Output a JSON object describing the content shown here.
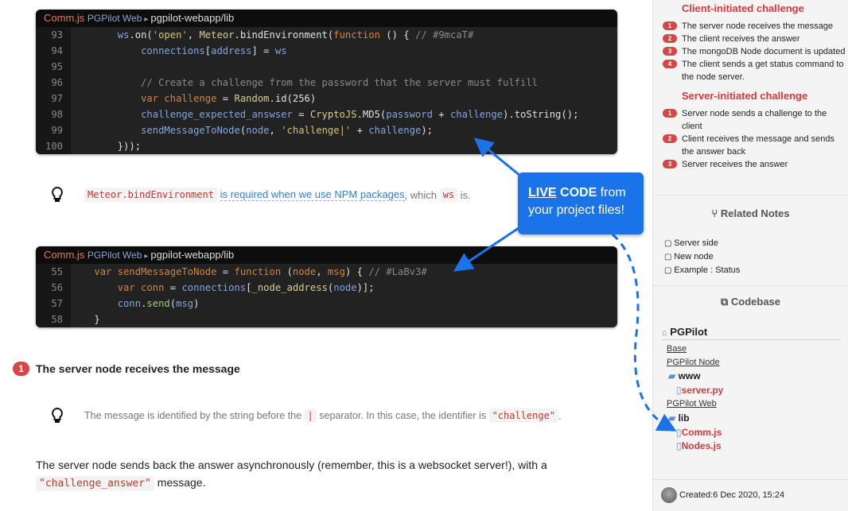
{
  "code_blocks": [
    {
      "file": "Comm.js",
      "project": "PGPilot Web",
      "path": "pgpilot-webapp/lib",
      "lines": [
        {
          "n": "93",
          "t": [
            [
              "        ",
              "w"
            ],
            [
              "ws",
              "i"
            ],
            [
              ".on(",
              "w"
            ],
            [
              "'open'",
              "s2"
            ],
            [
              ", ",
              "w"
            ],
            [
              "Meteor",
              "y"
            ],
            [
              ".bindEnvironment(",
              "w"
            ],
            [
              "function",
              "k"
            ],
            [
              " () { ",
              "w"
            ],
            [
              "// #9mcaT#",
              "c"
            ]
          ]
        },
        {
          "n": "94",
          "t": [
            [
              "            ",
              "w"
            ],
            [
              "connections",
              "i"
            ],
            [
              "[",
              "w"
            ],
            [
              "address",
              "i"
            ],
            [
              "] = ",
              "w"
            ],
            [
              "ws",
              "i"
            ]
          ]
        },
        {
          "n": "95",
          "t": []
        },
        {
          "n": "96",
          "t": [
            [
              "            ",
              "w"
            ],
            [
              "// Create a challenge from the password that the server must fulfill",
              "c"
            ]
          ]
        },
        {
          "n": "97",
          "t": [
            [
              "            ",
              "w"
            ],
            [
              "var",
              "k"
            ],
            [
              " ",
              "w"
            ],
            [
              "challenge",
              "k"
            ],
            [
              " = ",
              "w"
            ],
            [
              "Random",
              "y"
            ],
            [
              ".id(",
              "w"
            ],
            [
              "256",
              "w"
            ],
            [
              ")",
              "w"
            ]
          ]
        },
        {
          "n": "98",
          "t": [
            [
              "            ",
              "w"
            ],
            [
              "challenge_expected_answser",
              "i"
            ],
            [
              " = ",
              "w"
            ],
            [
              "CryptoJS",
              "y"
            ],
            [
              ".MD5(",
              "w"
            ],
            [
              "password",
              "i"
            ],
            [
              " + ",
              "w"
            ],
            [
              "challenge",
              "i"
            ],
            [
              ").toString();",
              "w"
            ]
          ]
        },
        {
          "n": "99",
          "t": [
            [
              "            ",
              "w"
            ],
            [
              "sendMessageToNode",
              "i"
            ],
            [
              "(",
              "w"
            ],
            [
              "node",
              "i"
            ],
            [
              ", ",
              "w"
            ],
            [
              "'challenge|'",
              "s2"
            ],
            [
              " + ",
              "w"
            ],
            [
              "challenge",
              "i"
            ],
            [
              ");",
              "w"
            ]
          ]
        },
        {
          "n": "100",
          "t": [
            [
              "        ",
              "w"
            ],
            [
              "}));",
              "w"
            ]
          ]
        }
      ]
    },
    {
      "file": "Comm.js",
      "project": "PGPilot Web",
      "path": "pgpilot-webapp/lib",
      "lines": [
        {
          "n": "55",
          "t": [
            [
              "    ",
              "w"
            ],
            [
              "var",
              "k"
            ],
            [
              " ",
              "w"
            ],
            [
              "sendMessageToNode",
              "k"
            ],
            [
              " = ",
              "w"
            ],
            [
              "function",
              "k"
            ],
            [
              " (",
              "w"
            ],
            [
              "node",
              "k"
            ],
            [
              ", ",
              "w"
            ],
            [
              "msg",
              "k"
            ],
            [
              ") { ",
              "w"
            ],
            [
              "// #LaBv3#",
              "c"
            ]
          ]
        },
        {
          "n": "56",
          "t": [
            [
              "        ",
              "w"
            ],
            [
              "var",
              "k"
            ],
            [
              " ",
              "w"
            ],
            [
              "conn",
              "k"
            ],
            [
              " = ",
              "w"
            ],
            [
              "connections",
              "i"
            ],
            [
              "[",
              "w"
            ],
            [
              "_node_address",
              "y"
            ],
            [
              "(",
              "w"
            ],
            [
              "node",
              "i"
            ],
            [
              ")];",
              "w"
            ]
          ]
        },
        {
          "n": "57",
          "t": [
            [
              "        ",
              "w"
            ],
            [
              "conn",
              "i"
            ],
            [
              ".",
              "w"
            ],
            [
              "send",
              "g"
            ],
            [
              "(",
              "w"
            ],
            [
              "msg",
              "i"
            ],
            [
              ")",
              "w"
            ]
          ]
        },
        {
          "n": "58",
          "t": [
            [
              "    ",
              "w"
            ],
            [
              "}",
              "w"
            ]
          ]
        }
      ]
    }
  ],
  "tip1": {
    "code": "Meteor.bindEnvironment",
    "link": "is required when we use NPM packages",
    "mid": ", which ",
    "code2": "ws",
    "end": " is."
  },
  "step": {
    "num": "1",
    "title": "The server node receives the message"
  },
  "tip2": {
    "a": "The message is identified by the string before the ",
    "code": "|",
    "b": " separator. In this case, the identifier is ",
    "code2": "\"challenge\"",
    "c": "."
  },
  "para": {
    "a": "The server node sends back the answer asynchronously (remember, this is a websocket server!), with a",
    "code": "\"challenge_answer\"",
    "b": " message."
  },
  "callout": {
    "strong": "LIVE",
    "bold": " CODE",
    "rest": " from",
    "line2": "your project files!"
  },
  "sidebar": {
    "client_title": "Client-initiated challenge",
    "client_steps": [
      {
        "n": "1",
        "t": "The server node receives the message"
      },
      {
        "n": "2",
        "t": "The client receives the answer"
      },
      {
        "n": "3",
        "t": "The mongoDB Node document is updated"
      },
      {
        "n": "4",
        "t": "The client sends a get status command to the node server."
      }
    ],
    "server_title": "Server-initiated challenge",
    "server_steps": [
      {
        "n": "1",
        "t": "Server node sends a challenge to the client"
      },
      {
        "n": "2",
        "t": "Client receives the message and sends the answer back"
      },
      {
        "n": "3",
        "t": "Server receives the answer"
      }
    ],
    "related_title": "Related Notes",
    "related": [
      "Server side",
      "New node",
      "Example : Status"
    ],
    "codebase_title": "Codebase",
    "repo": "PGPilot",
    "tree": {
      "base": "Base",
      "node": "PGPilot Node",
      "www": "www",
      "server": "server.py",
      "web": "PGPilot Web",
      "lib": "lib",
      "comm": "Comm.js",
      "nodes": "Nodes.js"
    },
    "created": "Created:6 Dec 2020, 15:24"
  },
  "colors": {
    "accent": "#d63a3a",
    "callout": "#1a73e8"
  }
}
